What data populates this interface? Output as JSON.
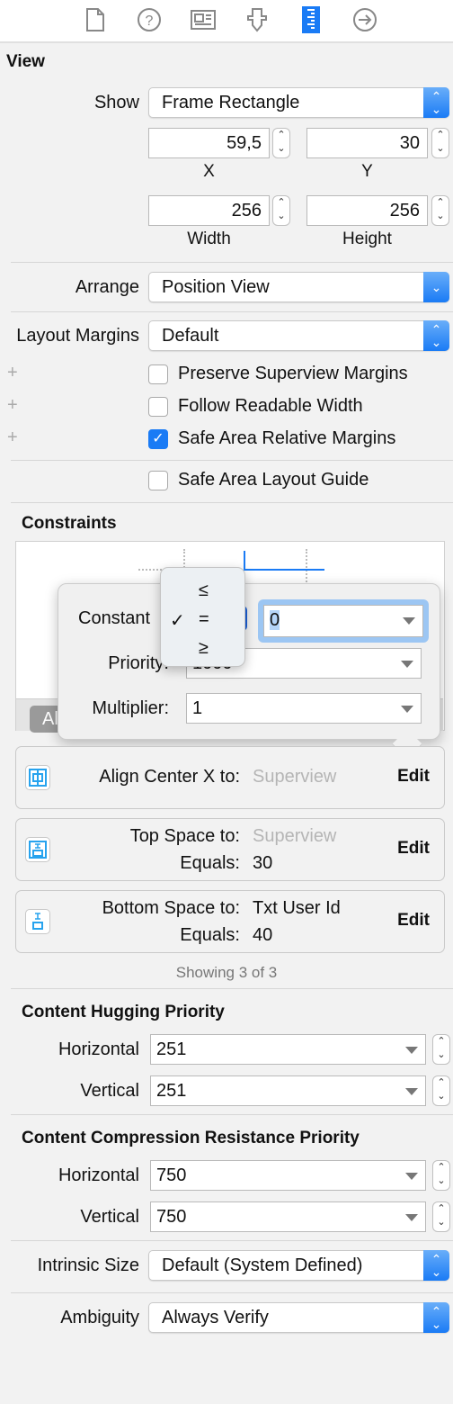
{
  "toolbar": {
    "icons": [
      "file-icon",
      "help-icon",
      "identity-icon",
      "attributes-icon",
      "size-ruler-icon",
      "connections-icon"
    ],
    "active": "size-ruler-icon",
    "accent": "#1a7bf5"
  },
  "view": {
    "title": "View",
    "show_label": "Show",
    "show_value": "Frame Rectangle",
    "x": "59,5",
    "y": "30",
    "x_label": "X",
    "y_label": "Y",
    "width": "256",
    "height": "256",
    "width_label": "Width",
    "height_label": "Height",
    "arrange_label": "Arrange",
    "arrange_value": "Position View",
    "layout_margins_label": "Layout Margins",
    "layout_margins_value": "Default",
    "checkboxes": [
      {
        "label": "Preserve Superview Margins",
        "checked": false
      },
      {
        "label": "Follow Readable Width",
        "checked": false
      },
      {
        "label": "Safe Area Relative Margins",
        "checked": true
      }
    ],
    "safe_area_guide": {
      "label": "Safe Area Layout Guide",
      "checked": false
    }
  },
  "constraints": {
    "title": "Constraints",
    "filter_button": "All",
    "popover": {
      "constant_label": "Constant",
      "constant_value": "0",
      "priority_label": "Priority:",
      "priority_value": "1000",
      "multiplier_label": "Multiplier:",
      "multiplier_value": "1",
      "relation_menu": [
        "≤",
        "=",
        "≥"
      ],
      "relation_selected": "=",
      "check": "✓"
    },
    "rows": [
      {
        "icon": "align-center-x-icon",
        "line1_label": "Align Center X to:",
        "line1_value": "Superview",
        "line1_dim": true,
        "edit": "Edit"
      },
      {
        "icon": "top-space-icon",
        "line1_label": "Top Space to:",
        "line1_value": "Superview",
        "line1_dim": true,
        "line2_label": "Equals:",
        "line2_value": "30",
        "edit": "Edit"
      },
      {
        "icon": "bottom-space-icon",
        "line1_label": "Bottom Space to:",
        "line1_value": "Txt User Id",
        "line1_dim": false,
        "line2_label": "Equals:",
        "line2_value": "40",
        "edit": "Edit"
      }
    ],
    "showing": "Showing 3 of 3"
  },
  "hugging": {
    "title": "Content Hugging Priority",
    "horizontal_label": "Horizontal",
    "horizontal": "251",
    "vertical_label": "Vertical",
    "vertical": "251"
  },
  "compression": {
    "title": "Content Compression Resistance Priority",
    "horizontal_label": "Horizontal",
    "horizontal": "750",
    "vertical_label": "Vertical",
    "vertical": "750"
  },
  "intrinsic": {
    "label": "Intrinsic Size",
    "value": "Default (System Defined)"
  },
  "ambiguity": {
    "label": "Ambiguity",
    "value": "Always Verify"
  }
}
